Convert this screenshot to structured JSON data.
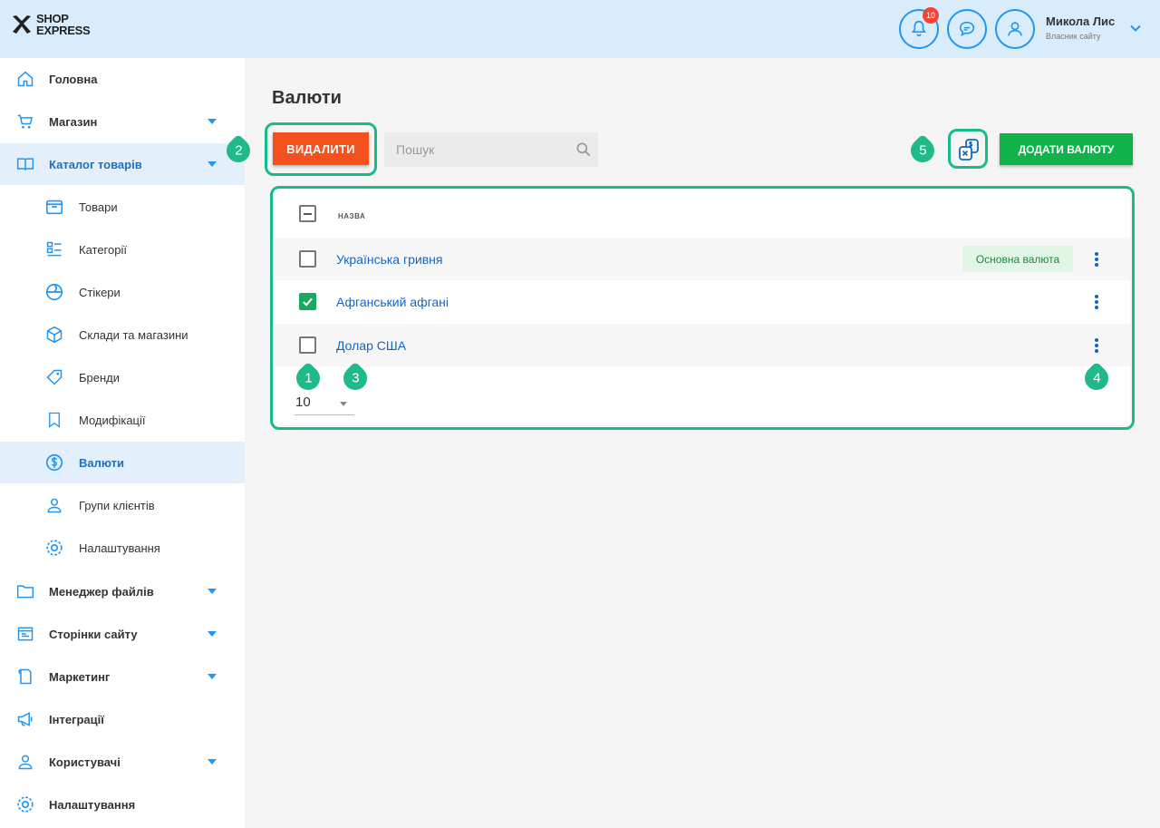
{
  "header": {
    "logo_line1": "SHOP",
    "logo_line2": "EXPRESS",
    "notifications_count": "10",
    "user_name": "Микола Лис",
    "user_role": "Власник сайту"
  },
  "sidebar": {
    "items": [
      {
        "label": "Головна",
        "icon": "home-icon"
      },
      {
        "label": "Магазин",
        "icon": "cart-icon"
      },
      {
        "label": "Каталог товарів",
        "icon": "book-icon"
      },
      {
        "label": "Товари",
        "icon": "box-icon"
      },
      {
        "label": "Категорії",
        "icon": "categories-icon"
      },
      {
        "label": "Стікери",
        "icon": "sticker-icon"
      },
      {
        "label": "Склади та магазини",
        "icon": "warehouse-icon"
      },
      {
        "label": "Бренди",
        "icon": "tag-icon"
      },
      {
        "label": "Модифікації",
        "icon": "bookmark-icon"
      },
      {
        "label": "Валюти",
        "icon": "currency-icon"
      },
      {
        "label": "Групи клієнтів",
        "icon": "users-icon"
      },
      {
        "label": "Налаштування",
        "icon": "gear-icon"
      },
      {
        "label": "Менеджер файлів",
        "icon": "folder-icon"
      },
      {
        "label": "Сторінки сайту",
        "icon": "pages-icon"
      },
      {
        "label": "Маркетинг",
        "icon": "marketing-icon"
      },
      {
        "label": "Інтеграції",
        "icon": "megaphone-icon"
      },
      {
        "label": "Користувачі",
        "icon": "user-icon"
      },
      {
        "label": "Налаштування",
        "icon": "gear-icon"
      }
    ]
  },
  "main": {
    "title": "Валюти",
    "delete_label": "ВИДАЛИТИ",
    "search_placeholder": "Пошук",
    "add_label": "ДОДАТИ ВАЛЮТУ",
    "column_name": "НАЗВА",
    "rows": [
      {
        "name": "Українська гривня",
        "badge": "Основна валюта",
        "checked": false
      },
      {
        "name": "Афганський афгані",
        "badge": "",
        "checked": true
      },
      {
        "name": "Долар США",
        "badge": "",
        "checked": false
      }
    ],
    "per_page": "10"
  },
  "annotations": [
    "1",
    "2",
    "3",
    "4",
    "5"
  ],
  "colors": {
    "accent": "#2196f3",
    "annotation": "#18b98a",
    "delete": "#f4511e",
    "add": "#10b24b",
    "link": "#1565c0"
  }
}
